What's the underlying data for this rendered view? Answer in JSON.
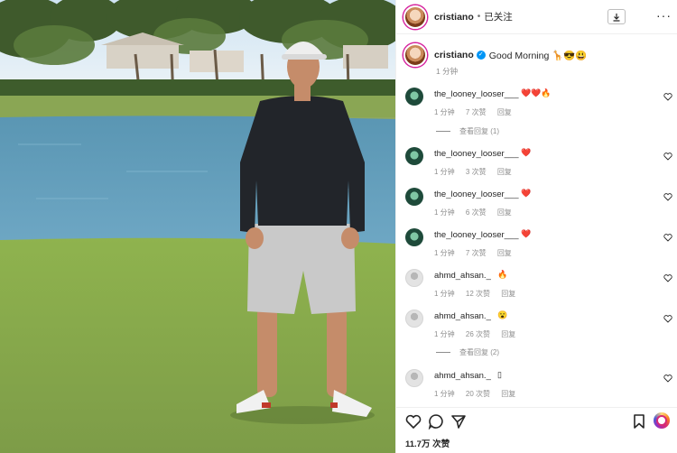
{
  "post": {
    "username": "cristiano",
    "header_separator": "•",
    "follow_status": "已关注",
    "more_label": "···",
    "caption": "Good Morning 🦒😎😃",
    "caption_time": "1 分钟"
  },
  "labels": {
    "reply": "回复",
    "view_replies_1": "查看回复 (1)",
    "view_replies_2": "查看回复 (2)"
  },
  "comments": [
    {
      "user": "the_looney_looser___",
      "emoji": "❤️❤️🔥",
      "time": "1 分钟",
      "likes": "7 次赞"
    },
    {
      "user": "the_looney_looser___",
      "emoji": "❤️",
      "time": "1 分钟",
      "likes": "3 次赞"
    },
    {
      "user": "the_looney_looser___",
      "emoji": "❤️",
      "time": "1 分钟",
      "likes": "6 次赞"
    },
    {
      "user": "the_looney_looser___",
      "emoji": "❤️",
      "time": "1 分钟",
      "likes": "7 次赞"
    },
    {
      "user": "ahmd_ahsan._",
      "emoji": "🔥",
      "time": "1 分钟",
      "likes": "12 次赞"
    },
    {
      "user": "ahmd_ahsan._",
      "emoji": "😮",
      "time": "1 分钟",
      "likes": "26 次赞"
    },
    {
      "user": "ahmd_ahsan._",
      "emoji": "▯",
      "time": "1 分钟",
      "likes": "20 次赞"
    }
  ],
  "footer": {
    "likes_count": "11.7万 次赞"
  },
  "icons": {
    "download": "download-icon",
    "more": "more-options-icon",
    "heart": "heart-icon",
    "comment": "comment-icon",
    "share": "share-icon",
    "save": "bookmark-icon",
    "verified": "verified-badge-icon"
  },
  "colors": {
    "brand_blue": "#0095f6",
    "heart_red": "#ed1c24",
    "muted_text": "#8e8e8e",
    "grass": "#7d9e4a",
    "water": "#5f9bb8"
  }
}
